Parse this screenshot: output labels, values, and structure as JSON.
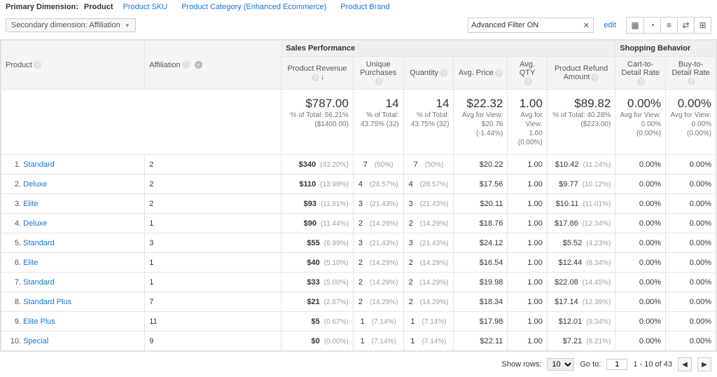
{
  "primary_dim": {
    "label": "Primary Dimension:",
    "active": "Product",
    "options": [
      "Product SKU",
      "Product Category (Enhanced Ecommerce)",
      "Product Brand"
    ]
  },
  "secondary_dim": {
    "label": "Secondary dimension: Affiliation"
  },
  "filter": {
    "text": "Advanced Filter ON",
    "edit": "edit"
  },
  "headers": {
    "product": "Product",
    "affiliation": "Affiliation",
    "group_sales": "Sales Performance",
    "group_shop": "Shopping Behavior",
    "rev": "Product Revenue",
    "up": "Unique Purchases",
    "qty": "Quantity",
    "avgp": "Avg. Price",
    "avgq": "Avg. QTY",
    "refund": "Product Refund Amount",
    "c2d": "Cart-to-Detail Rate",
    "b2d": "Buy-to-Detail Rate"
  },
  "summary": {
    "rev": {
      "big": "$787.00",
      "l1": "% of Total: 56.21%",
      "l2": "($1400.00)"
    },
    "up": {
      "big": "14",
      "l1": "% of Total:",
      "l2": "43.75% (32)"
    },
    "qty": {
      "big": "14",
      "l1": "% of Total:",
      "l2": "43.75% (32)"
    },
    "avgp": {
      "big": "$22.32",
      "l1": "Avg for View:",
      "l2": "$20.76 (-1.44%)"
    },
    "avgq": {
      "big": "1.00",
      "l1": "Avg for View: 1.00",
      "l2": "(0.00%)"
    },
    "refund": {
      "big": "$89.82",
      "l1": "% of Total: 40.28%",
      "l2": "($223.00)"
    },
    "c2d": {
      "big": "0.00%",
      "l1": "Avg for View: 0.00%",
      "l2": "(0.00%)"
    },
    "b2d": {
      "big": "0.00%",
      "l1": "Avg for View: 0.00%",
      "l2": "(0.00%)"
    }
  },
  "rows": [
    {
      "i": "1.",
      "prod": "Standard",
      "aff": "2",
      "rev": "$340",
      "revp": "(43.20%)",
      "up": "7",
      "upp": "(50%)",
      "q": "7",
      "qp": "(50%)",
      "avgp": "$20.22",
      "avgq": "1.00",
      "ref": "$10.42",
      "refp": "(11.24%)",
      "c2d": "0.00%",
      "b2d": "0.00%"
    },
    {
      "i": "2.",
      "prod": "Deluxe",
      "aff": "2",
      "rev": "$110",
      "revp": "(13.98%)",
      "up": "4",
      "upp": "(28.57%)",
      "q": "4",
      "qp": "(28.57%)",
      "avgp": "$17.56",
      "avgq": "1.00",
      "ref": "$9.77",
      "refp": "(10.12%)",
      "c2d": "0.00%",
      "b2d": "0.00%"
    },
    {
      "i": "3.",
      "prod": "Elite",
      "aff": "2",
      "rev": "$93",
      "revp": "(11.81%)",
      "up": "3",
      "upp": "(21.43%)",
      "q": "3",
      "qp": "(21.43%)",
      "avgp": "$20.11",
      "avgq": "1.00",
      "ref": "$10.11",
      "refp": "(11.01%)",
      "c2d": "0.00%",
      "b2d": "0.00%"
    },
    {
      "i": "4.",
      "prod": "Deluxe",
      "aff": "1",
      "rev": "$90",
      "revp": "(11.44%)",
      "up": "2",
      "upp": "(14.29%)",
      "q": "2",
      "qp": "(14.29%)",
      "avgp": "$18.76",
      "avgq": "1.00",
      "ref": "$17.86",
      "refp": "(12.34%)",
      "c2d": "0.00%",
      "b2d": "0.00%"
    },
    {
      "i": "5.",
      "prod": "Standard",
      "aff": "3",
      "rev": "$55",
      "revp": "(6.99%)",
      "up": "3",
      "upp": "(21.43%)",
      "q": "3",
      "qp": "(21.43%)",
      "avgp": "$24.12",
      "avgq": "1.00",
      "ref": "$5.52",
      "refp": "(4.23%)",
      "c2d": "0.00%",
      "b2d": "0.00%"
    },
    {
      "i": "6.",
      "prod": "Elite",
      "aff": "1",
      "rev": "$40",
      "revp": "(5.10%)",
      "up": "2",
      "upp": "(14.29%)",
      "q": "2",
      "qp": "(14.29%)",
      "avgp": "$16.54",
      "avgq": "1.00",
      "ref": "$12.44",
      "refp": "(8.34%)",
      "c2d": "0.00%",
      "b2d": "0.00%"
    },
    {
      "i": "7.",
      "prod": "Standard",
      "aff": "1",
      "rev": "$33",
      "revp": "(5.00%)",
      "up": "2",
      "upp": "(14.29%)",
      "q": "2",
      "qp": "(14.29%)",
      "avgp": "$19.98",
      "avgq": "1.00",
      "ref": "$22.08",
      "refp": "(14.45%)",
      "c2d": "0.00%",
      "b2d": "0.00%"
    },
    {
      "i": "8.",
      "prod": "Standard Plus",
      "aff": "7",
      "rev": "$21",
      "revp": "(2.67%)",
      "up": "2",
      "upp": "(14.29%)",
      "q": "2",
      "qp": "(14.29%)",
      "avgp": "$18.34",
      "avgq": "1.00",
      "ref": "$17.14",
      "refp": "(12.39%)",
      "c2d": "0.00%",
      "b2d": "0.00%"
    },
    {
      "i": "9.",
      "prod": "Elite Plus",
      "aff": "11",
      "rev": "$5",
      "revp": "(0.67%)",
      "up": "1",
      "upp": "(7.14%)",
      "q": "1",
      "qp": "(7.14%)",
      "avgp": "$17.98",
      "avgq": "1.00",
      "ref": "$12.01",
      "refp": "(9.34%)",
      "c2d": "0.00%",
      "b2d": "0.00%"
    },
    {
      "i": "10.",
      "prod": "Special",
      "aff": "9",
      "rev": "$0",
      "revp": "(0.00%)",
      "up": "1",
      "upp": "(7.14%)",
      "q": "1",
      "qp": "(7.14%)",
      "avgp": "$22.11",
      "avgq": "1.00",
      "ref": "$7.21",
      "refp": "(8.21%)",
      "c2d": "0.00%",
      "b2d": "0.00%"
    }
  ],
  "pager": {
    "show_rows_label": "Show rows:",
    "show_rows_value": "10",
    "goto_label": "Go to:",
    "goto_value": "1",
    "range": "1 - 10 of 43"
  },
  "chart_data": {
    "type": "table",
    "title": "Sales Performance by Product × Affiliation",
    "columns": [
      "Product",
      "Affiliation",
      "Product Revenue",
      "Unique Purchases",
      "Quantity",
      "Avg. Price",
      "Avg. QTY",
      "Product Refund Amount",
      "Cart-to-Detail Rate",
      "Buy-to-Detail Rate"
    ],
    "totals": {
      "Product Revenue": 787.0,
      "Unique Purchases": 14,
      "Quantity": 14,
      "Avg. Price": 22.32,
      "Avg. QTY": 1.0,
      "Product Refund Amount": 89.82,
      "Cart-to-Detail Rate": 0.0,
      "Buy-to-Detail Rate": 0.0
    },
    "rows": [
      [
        "Standard",
        "2",
        340,
        7,
        7,
        20.22,
        1.0,
        10.42,
        0.0,
        0.0
      ],
      [
        "Deluxe",
        "2",
        110,
        4,
        4,
        17.56,
        1.0,
        9.77,
        0.0,
        0.0
      ],
      [
        "Elite",
        "2",
        93,
        3,
        3,
        20.11,
        1.0,
        10.11,
        0.0,
        0.0
      ],
      [
        "Deluxe",
        "1",
        90,
        2,
        2,
        18.76,
        1.0,
        17.86,
        0.0,
        0.0
      ],
      [
        "Standard",
        "3",
        55,
        3,
        3,
        24.12,
        1.0,
        5.52,
        0.0,
        0.0
      ],
      [
        "Elite",
        "1",
        40,
        2,
        2,
        16.54,
        1.0,
        12.44,
        0.0,
        0.0
      ],
      [
        "Standard",
        "1",
        33,
        2,
        2,
        19.98,
        1.0,
        22.08,
        0.0,
        0.0
      ],
      [
        "Standard Plus",
        "7",
        21,
        2,
        2,
        18.34,
        1.0,
        17.14,
        0.0,
        0.0
      ],
      [
        "Elite Plus",
        "11",
        5,
        1,
        1,
        17.98,
        1.0,
        12.01,
        0.0,
        0.0
      ],
      [
        "Special",
        "9",
        0,
        1,
        1,
        22.11,
        1.0,
        7.21,
        0.0,
        0.0
      ]
    ]
  }
}
